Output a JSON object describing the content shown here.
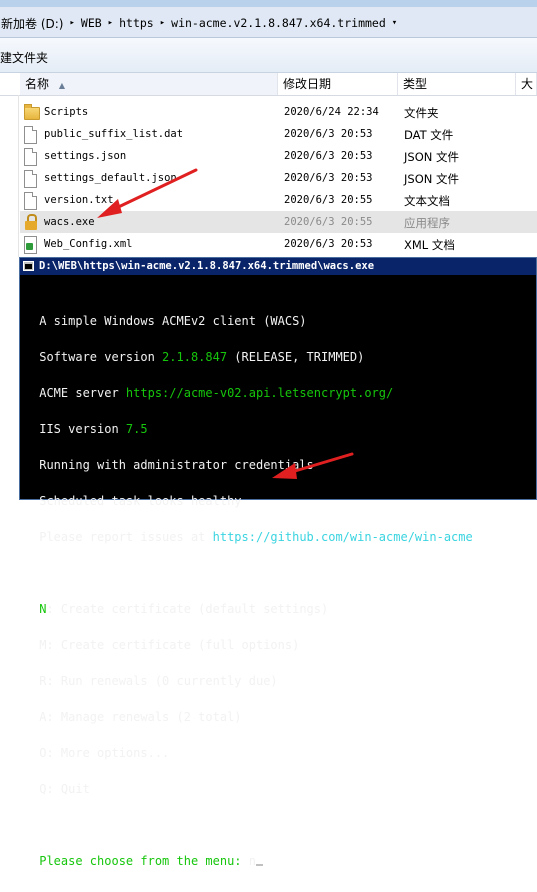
{
  "title_ghost": "",
  "breadcrumb": [
    "新加卷 (D:)",
    "WEB",
    "https",
    "win-acme.v2.1.8.847.x64.trimmed"
  ],
  "toolbar": {
    "new_folder_label": "建文件夹"
  },
  "columns": {
    "name": "名称",
    "date": "修改日期",
    "type": "类型",
    "size": "大"
  },
  "files": [
    {
      "name": "Scripts",
      "date": "2020/6/24 22:34",
      "type": "文件夹",
      "icon": "folder-icon"
    },
    {
      "name": "public_suffix_list.dat",
      "date": "2020/6/3 20:53",
      "type": "DAT 文件",
      "icon": "document-icon"
    },
    {
      "name": "settings.json",
      "date": "2020/6/3 20:53",
      "type": "JSON 文件",
      "icon": "document-icon"
    },
    {
      "name": "settings_default.json",
      "date": "2020/6/3 20:53",
      "type": "JSON 文件",
      "icon": "document-icon"
    },
    {
      "name": "version.txt",
      "date": "2020/6/3 20:55",
      "type": "文本文档",
      "icon": "document-icon"
    },
    {
      "name": "wacs.exe",
      "date": "2020/6/3 20:55",
      "type": "应用程序",
      "icon": "lock-icon"
    },
    {
      "name": "Web_Config.xml",
      "date": "2020/6/3 20:53",
      "type": "XML 文档",
      "icon": "xml-icon"
    }
  ],
  "console": {
    "title": "D:\\WEB\\https\\win-acme.v2.1.8.847.x64.trimmed\\wacs.exe",
    "line_client": " A simple Windows ACMEv2 client (WACS)",
    "software_prefix": " Software version ",
    "software_version": "2.1.8.847",
    "software_suffix": " (RELEASE, TRIMMED)",
    "acme_prefix": " ACME server ",
    "acme_url": "https://acme-v02.api.letsencrypt.org/",
    "iis_prefix": " IIS version ",
    "iis_version": "7.5",
    "line_admin": " Running with administrator credentials",
    "line_task": " Scheduled task looks healthy",
    "report_prefix": " Please report issues at ",
    "report_url": "https://github.com/win-acme/win-acme",
    "menu": [
      {
        "key": " N",
        "text": ": Create certificate (default settings)"
      },
      {
        "key": " M",
        "text": ": Create certificate (full options)"
      },
      {
        "key": " R",
        "text": ": Run renewals (0 currently due)"
      },
      {
        "key": " A",
        "text": ": Manage renewals (2 total)"
      },
      {
        "key": " O",
        "text": ": More options..."
      },
      {
        "key": " Q",
        "text": ": Quit"
      }
    ],
    "prompt": " Please choose from the menu: ",
    "input": "n"
  },
  "colors": {
    "annotation_red": "#e02020",
    "console_green": "#16c60c",
    "console_cyan": "#3ad4e0"
  }
}
